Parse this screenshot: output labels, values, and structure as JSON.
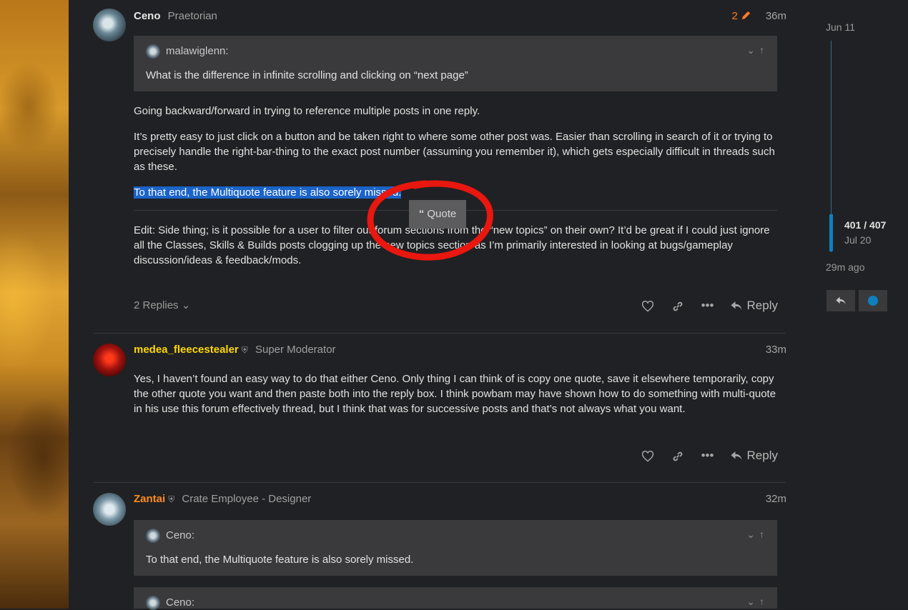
{
  "posts": [
    {
      "username": "Ceno",
      "user_title": "Praetorian",
      "edit_count": "2",
      "time": "36m",
      "quote": {
        "author": "malawiglenn:",
        "text": "What is the difference in infinite scrolling and clicking on “next page”"
      },
      "paragraphs": [
        "Going backward/forward in trying to reference multiple posts in one reply.",
        "It’s pretty easy to just click on a button and be taken right to where some other post was. Easier than scrolling in search of it or trying to precisely handle the right-bar-thing to the exact post number (assuming you remember it), which gets especially difficult in threads such as these.",
        "To that end, the Multiquote feature is also sorely missed.",
        "Edit: Side thing; is it possible for a user to filter out forum sections from the “new topics” on their own? It’d be great if I could just ignore all the Classes, Skills & Builds posts clogging up the new topics section as I’m primarily interested in looking at bugs/gameplay discussion/ideas & feedback/mods."
      ],
      "replies_label": "2 Replies",
      "reply_label": "Reply"
    },
    {
      "username": "medea_fleecestealer",
      "user_title": "Super Moderator",
      "time": "33m",
      "paragraphs": [
        "Yes, I haven’t found an easy way to do that either Ceno. Only thing I can think of is copy one quote, save it elsewhere temporarily, copy the other quote you want and then paste both into the reply box. I think powbam may have shown how to do something with multi-quote in his use this forum effectively thread, but I think that was for successive posts and that’s not always what you want."
      ],
      "reply_label": "Reply"
    },
    {
      "username": "Zantai",
      "user_title": "Crate Employee - Designer",
      "time": "32m",
      "quotes": [
        {
          "author": "Ceno:",
          "text": "To that end, the Multiquote feature is also sorely missed."
        },
        {
          "author": "Ceno:",
          "text": ""
        }
      ]
    }
  ],
  "quote_button": "Quote",
  "timeline": {
    "start_date": "Jun 11",
    "position": "401 / 407",
    "current_date": "Jul 20",
    "last_activity": "29m ago"
  },
  "colors": {
    "highlight": "#1a63c8",
    "mod_name": "#ffd700",
    "staff_name": "#ff8c1a",
    "annotation_circle": "#e8170f",
    "timeline_accent": "#0f7fbd"
  }
}
